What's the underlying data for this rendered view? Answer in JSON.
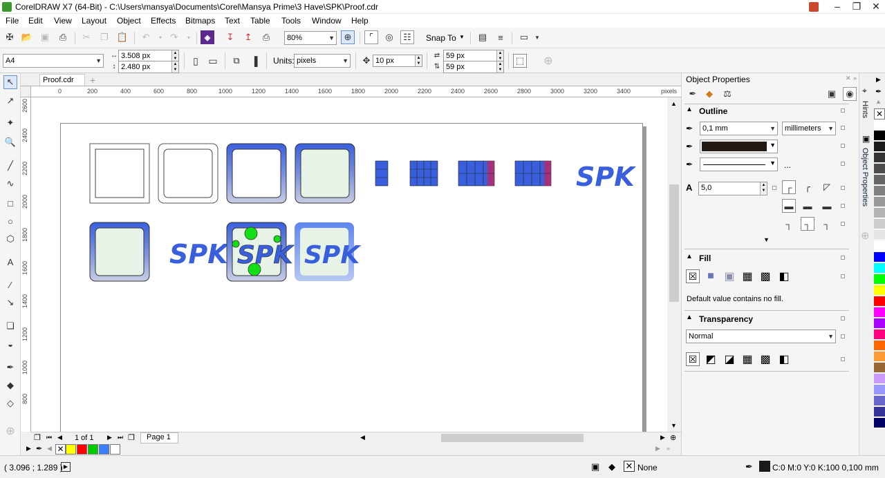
{
  "window": {
    "title": "CorelDRAW X7 (64-Bit) - C:\\Users\\mansya\\Documents\\Corel\\Mansya Prime\\3 Have\\SPK\\Proof.cdr",
    "controls": [
      "▬",
      "❐",
      "✕"
    ]
  },
  "menu": [
    "File",
    "Edit",
    "View",
    "Layout",
    "Object",
    "Effects",
    "Bitmaps",
    "Text",
    "Table",
    "Tools",
    "Window",
    "Help"
  ],
  "toolbar": {
    "zoom": "80%",
    "snap_to": "Snap To"
  },
  "propbar": {
    "page_size": "A4",
    "width": "3.508 px",
    "height": "2.480 px",
    "units_label": "Units:",
    "units": "pixels",
    "nudge": "10 px",
    "dup_x": "59 px",
    "dup_y": "59 px"
  },
  "document": {
    "tab": "Proof.cdr",
    "ruler_unit": "pixels",
    "h_ruler": [
      "0",
      "200",
      "400",
      "600",
      "800",
      "1000",
      "1200",
      "1400",
      "1600",
      "1800",
      "2000",
      "2200",
      "2400",
      "2600",
      "2800",
      "3000",
      "3200",
      "3400"
    ],
    "v_ruler": [
      "2600",
      "2400",
      "2200",
      "2000",
      "1800",
      "1600",
      "1400",
      "1200",
      "1000",
      "800"
    ],
    "logo_text": "SPK"
  },
  "pager": {
    "page_count": "1 of 1",
    "page_tab": "Page 1"
  },
  "status": {
    "coords": "( 3.096 ; 1.289 )",
    "fill": "None",
    "outline": "C:0 M:0 Y:0 K:100  0,100 mm"
  },
  "object_properties": {
    "title": "Object Properties",
    "outline": {
      "header": "Outline",
      "width": "0,1 mm",
      "units": "millimeters",
      "dots": "...",
      "miter": "5,0"
    },
    "fill": {
      "header": "Fill",
      "note": "Default value contains no fill."
    },
    "transparency": {
      "header": "Transparency",
      "mode": "Normal"
    }
  },
  "side_tabs": [
    "Hints",
    "Object Properties"
  ],
  "colors": {
    "logo_blue": "#3a5fdc",
    "page_fill": "#e6f3e6",
    "accent_green": "#13e013"
  },
  "palette": [
    "#ffffff",
    "#000000",
    "#1a1a1a",
    "#333333",
    "#4d4d4d",
    "#666666",
    "#808080",
    "#999999",
    "#b3b3b3",
    "#cccccc",
    "#e6e6e6",
    "#ffffff",
    "#0000ff",
    "#00ffff",
    "#00ff00",
    "#ffff00",
    "#ff0000",
    "#ff00ff",
    "#aa00ff",
    "#ff0080",
    "#ff6600",
    "#ff9933",
    "#996633",
    "#cc99ff",
    "#9999ff",
    "#6666cc",
    "#333399",
    "#000066"
  ],
  "doc_palette": [
    "#ffff00",
    "#ff0000",
    "#00cc00",
    "#3a7fff",
    "#ffffff"
  ]
}
